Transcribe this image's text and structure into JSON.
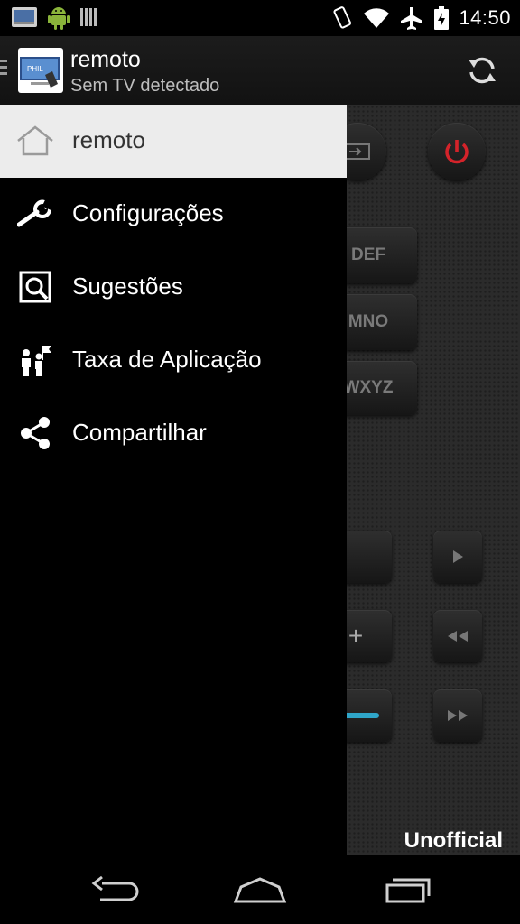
{
  "status_bar": {
    "time": "14:50",
    "left_icons": [
      "screenshot-icon",
      "android-icon",
      "barcode-icon"
    ],
    "right_icons": [
      "vibrate-icon",
      "wifi-icon",
      "airplane-icon",
      "battery-icon"
    ]
  },
  "action_bar": {
    "title": "remoto",
    "subtitle": "Sem TV detectado",
    "app_icon_text": "PHIL",
    "actions": [
      "refresh-icon"
    ]
  },
  "drawer": {
    "items": [
      {
        "label": "remoto",
        "icon": "home-icon",
        "selected": true
      },
      {
        "label": "Configurações",
        "icon": "wrench-icon",
        "selected": false
      },
      {
        "label": "Sugestões",
        "icon": "suggestion-search-icon",
        "selected": false
      },
      {
        "label": "Taxa de Aplicação",
        "icon": "rate-flag-icon",
        "selected": false
      },
      {
        "label": "Compartilhar",
        "icon": "share-icon",
        "selected": false
      }
    ]
  },
  "remote": {
    "keys": [
      "DEF",
      "MNO",
      "WXYZ"
    ],
    "plus": "+",
    "watermark": "Unofficial",
    "accent_red": "#d4232a",
    "accent_blue": "#2fa6c9"
  },
  "nav_bar": {
    "buttons": [
      "back-icon",
      "home-icon",
      "recents-icon"
    ]
  },
  "colors": {
    "drawer_bg": "#000000",
    "selected_bg": "#ececec",
    "text": "#ffffff"
  }
}
